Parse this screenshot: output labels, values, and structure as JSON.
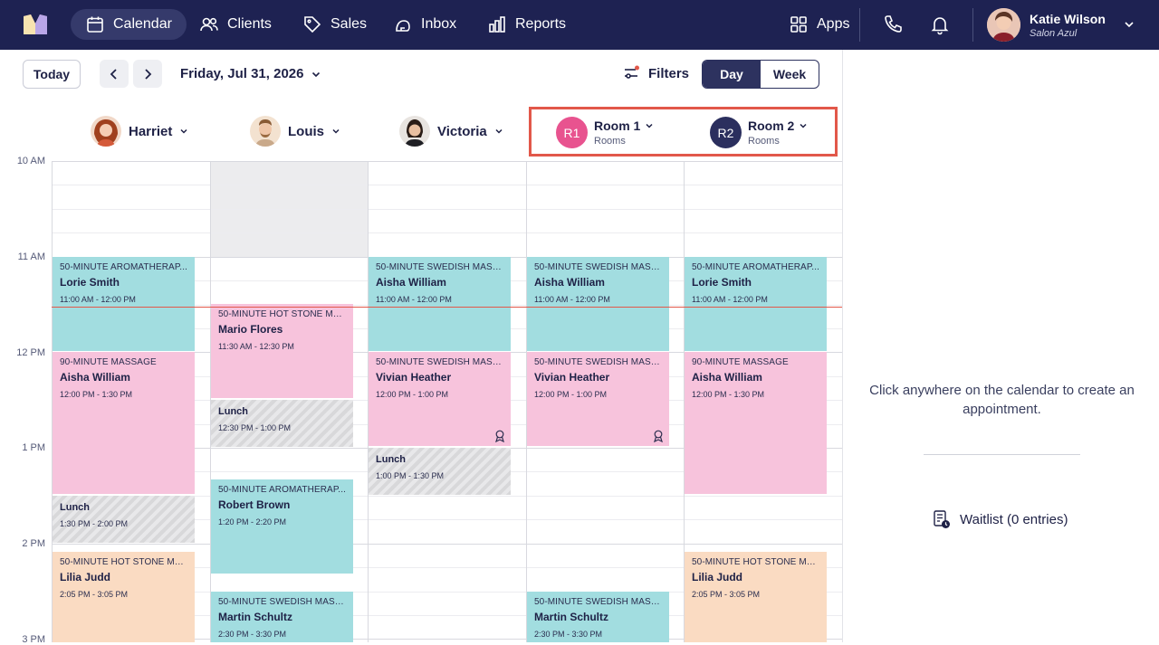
{
  "nav": {
    "items": [
      {
        "label": "Calendar",
        "icon": "calendar-icon",
        "active": true
      },
      {
        "label": "Clients",
        "icon": "users-icon"
      },
      {
        "label": "Sales",
        "icon": "tag-icon"
      },
      {
        "label": "Inbox",
        "icon": "inbox-icon"
      },
      {
        "label": "Reports",
        "icon": "bar-chart-icon"
      }
    ],
    "apps_label": "Apps"
  },
  "user": {
    "name": "Katie Wilson",
    "salon": "Salon Azul"
  },
  "toolbar": {
    "today_label": "Today",
    "date_label": "Friday, Jul 31, 2026",
    "filters_label": "Filters",
    "view_day": "Day",
    "view_week": "Week"
  },
  "staff": [
    {
      "name": "Harriet"
    },
    {
      "name": "Louis"
    },
    {
      "name": "Victoria"
    }
  ],
  "rooms": [
    {
      "badge": "R1",
      "name": "Room 1",
      "sub": "Rooms",
      "color": "#e8538f"
    },
    {
      "badge": "R2",
      "name": "Room 2",
      "sub": "Rooms",
      "color": "#2b2f5e"
    }
  ],
  "times": [
    "10 AM",
    "11 AM",
    "12 PM",
    "1 PM",
    "2 PM",
    "3 PM"
  ],
  "appointments": {
    "harriet": [
      {
        "service": "50-MINUTE AROMATHERAP...",
        "client": "Lorie Smith",
        "time": "11:00 AM - 12:00 PM"
      },
      {
        "service": "90-MINUTE MASSAGE",
        "client": "Aisha William",
        "time": "12:00 PM - 1:30 PM"
      },
      {
        "client": "Lunch",
        "time": "1:30 PM - 2:00 PM"
      },
      {
        "service": "50-MINUTE HOT STONE MAS...",
        "client": "Lilia Judd",
        "time": "2:05 PM - 3:05 PM"
      }
    ],
    "louis": [
      {
        "service": "50-MINUTE HOT STONE MAS...",
        "client": "Mario Flores",
        "time": "11:30 AM - 12:30 PM"
      },
      {
        "client": "Lunch",
        "time": "12:30 PM - 1:00 PM"
      },
      {
        "service": "50-MINUTE AROMATHERAP...",
        "client": "Robert Brown",
        "time": "1:20 PM - 2:20 PM"
      },
      {
        "service": "50-MINUTE SWEDISH MASS...",
        "client": "Martin Schultz",
        "time": "2:30 PM - 3:30 PM"
      }
    ],
    "victoria": [
      {
        "service": "50-MINUTE SWEDISH MASS...",
        "client": "Aisha William",
        "time": "11:00 AM - 12:00 PM"
      },
      {
        "service": "50-MINUTE SWEDISH MASS...",
        "client": "Vivian Heather",
        "time": "12:00 PM - 1:00 PM"
      },
      {
        "client": "Lunch",
        "time": "1:00 PM - 1:30 PM"
      }
    ],
    "room1": [
      {
        "service": "50-MINUTE SWEDISH MASS...",
        "client": "Aisha William",
        "time": "11:00 AM - 12:00 PM"
      },
      {
        "service": "50-MINUTE SWEDISH MASS...",
        "client": "Vivian Heather",
        "time": "12:00 PM - 1:00 PM"
      },
      {
        "service": "50-MINUTE SWEDISH MASS...",
        "client": "Martin Schultz",
        "time": "2:30 PM - 3:30 PM"
      }
    ],
    "room2": [
      {
        "service": "50-MINUTE AROMATHERAP...",
        "client": "Lorie Smith",
        "time": "11:00 AM - 12:00 PM"
      },
      {
        "service": "90-MINUTE MASSAGE",
        "client": "Aisha William",
        "time": "12:00 PM - 1:30 PM"
      },
      {
        "service": "50-MINUTE HOT STONE MAS...",
        "client": "Lilia Judd",
        "time": "2:05 PM - 3:05 PM"
      }
    ]
  },
  "side_panel": {
    "hint": "Click anywhere on the calendar to create an appointment.",
    "waitlist_label": "Waitlist (0 entries)"
  },
  "colors": {
    "nav_bg": "#1e2252",
    "teal": "#a2dde0",
    "pink": "#f7c3dc",
    "peach": "#fadbc2",
    "now_line": "#e2584a"
  }
}
